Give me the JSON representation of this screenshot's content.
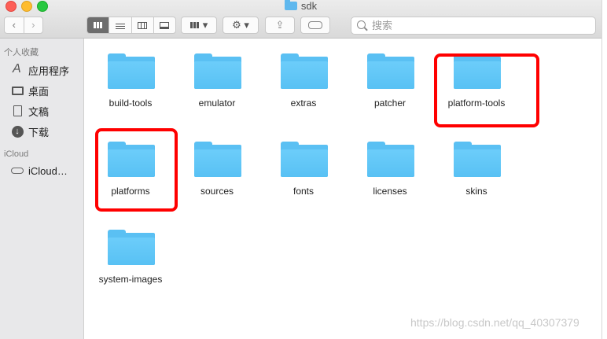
{
  "window": {
    "title": "sdk",
    "folder_icon": "folder-icon"
  },
  "toolbar": {
    "back": "‹",
    "forward": "›",
    "arrange_label": "▾",
    "action_label": "⚙ ▾",
    "share_label": "⇪",
    "search_placeholder": "搜索"
  },
  "sidebar": {
    "favorites_header": "个人收藏",
    "items": [
      {
        "label": "应用程序",
        "icon": "applications-icon"
      },
      {
        "label": "桌面",
        "icon": "desktop-icon"
      },
      {
        "label": "文稿",
        "icon": "documents-icon"
      },
      {
        "label": "下载",
        "icon": "downloads-icon"
      }
    ],
    "icloud_header": "iCloud",
    "icloud_item": {
      "label": "iCloud…",
      "icon": "cloud-icon"
    }
  },
  "folders": [
    {
      "name": "build-tools"
    },
    {
      "name": "emulator"
    },
    {
      "name": "extras"
    },
    {
      "name": "patcher"
    },
    {
      "name": "platform-tools",
      "highlighted": true
    },
    {
      "name": "platforms",
      "highlighted": true
    },
    {
      "name": "sources"
    },
    {
      "name": "fonts"
    },
    {
      "name": "licenses"
    },
    {
      "name": "skins"
    },
    {
      "name": "system-images"
    }
  ],
  "highlight_color": "#ff0000",
  "folder_color": "#5ac0f3",
  "watermark": "https://blog.csdn.net/qq_40307379"
}
